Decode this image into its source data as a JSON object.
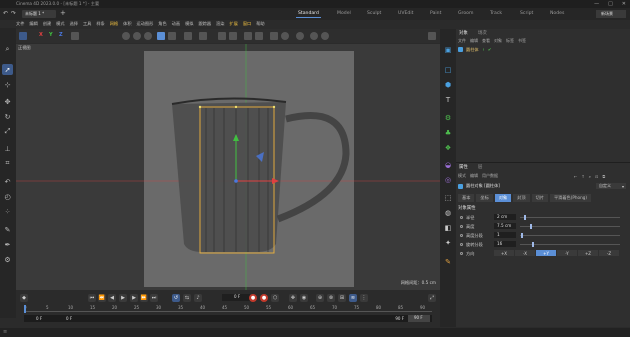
{
  "titlebar": {
    "title": "Cinema 4D 2023.0.0 - [未标题 1 *] - 主要",
    "min": "—",
    "max": "□",
    "close": "✕"
  },
  "doc_tab": "未标题 1 *",
  "layouts": [
    "Standard",
    "Model",
    "Sculpt",
    "UVEdit",
    "Paint",
    "Groom",
    "Track",
    "Script",
    "Nodes"
  ],
  "new_scene": "新场景",
  "menu": [
    "文件",
    "编辑",
    "创建",
    "模式",
    "选择",
    "工具",
    "样条",
    "网格",
    "体积",
    "运动图形",
    "角色",
    "动画",
    "模拟",
    "跟踪器",
    "渲染",
    "扩展",
    "窗口",
    "帮助"
  ],
  "viewport": {
    "name": "正视图",
    "grid_spacing": "网格间距：0.5 cm"
  },
  "axis_labels": {
    "x": "X",
    "y": "Y",
    "z": "Z"
  },
  "timeline": {
    "ticks": [
      "0",
      "5",
      "10",
      "15",
      "20",
      "25",
      "30",
      "35",
      "40",
      "45",
      "50",
      "55",
      "60",
      "65",
      "70",
      "75",
      "80",
      "85",
      "90"
    ],
    "current_frame": "0 F",
    "start": "0 F",
    "start2": "0 F",
    "end": "90 F",
    "end2": "90 F"
  },
  "object_manager": {
    "tabs": [
      "对象",
      "场次"
    ],
    "menu": [
      "文件",
      "编辑",
      "查看",
      "对象",
      "标签",
      "书签"
    ],
    "object_name": "圆柱体"
  },
  "attributes": {
    "tabs": [
      "属性",
      "层"
    ],
    "menu": [
      "模式",
      "编辑",
      "用户数据"
    ],
    "object_title": "圆柱对象 [圆柱体]",
    "mode_select": "自定义",
    "param_tabs": [
      "基本",
      "坐标",
      "对象",
      "封顶",
      "切片",
      "平滑着色(Phong)"
    ],
    "active_param_tab": "对象",
    "section": "对象属性",
    "params": [
      {
        "label": "半径",
        "value": "2 cm",
        "fill": 0.04
      },
      {
        "label": "高度",
        "value": "7.5 cm",
        "fill": 0.1
      },
      {
        "label": "高度分段",
        "value": "1",
        "fill": 0.01
      },
      {
        "label": "旋转分段",
        "value": "16",
        "fill": 0.12
      }
    ],
    "orientation_label": "方向",
    "orientation": [
      "+X",
      "-X",
      "+Y",
      "-Y",
      "+Z",
      "-Z"
    ],
    "orientation_active": "+Y"
  },
  "colors": {
    "accent": "#5b8fd6",
    "selection": "#f0b43c",
    "axis_x": "#e04040",
    "axis_y": "#40c040",
    "axis_z": "#4a78e0",
    "record": "#c0392b"
  }
}
